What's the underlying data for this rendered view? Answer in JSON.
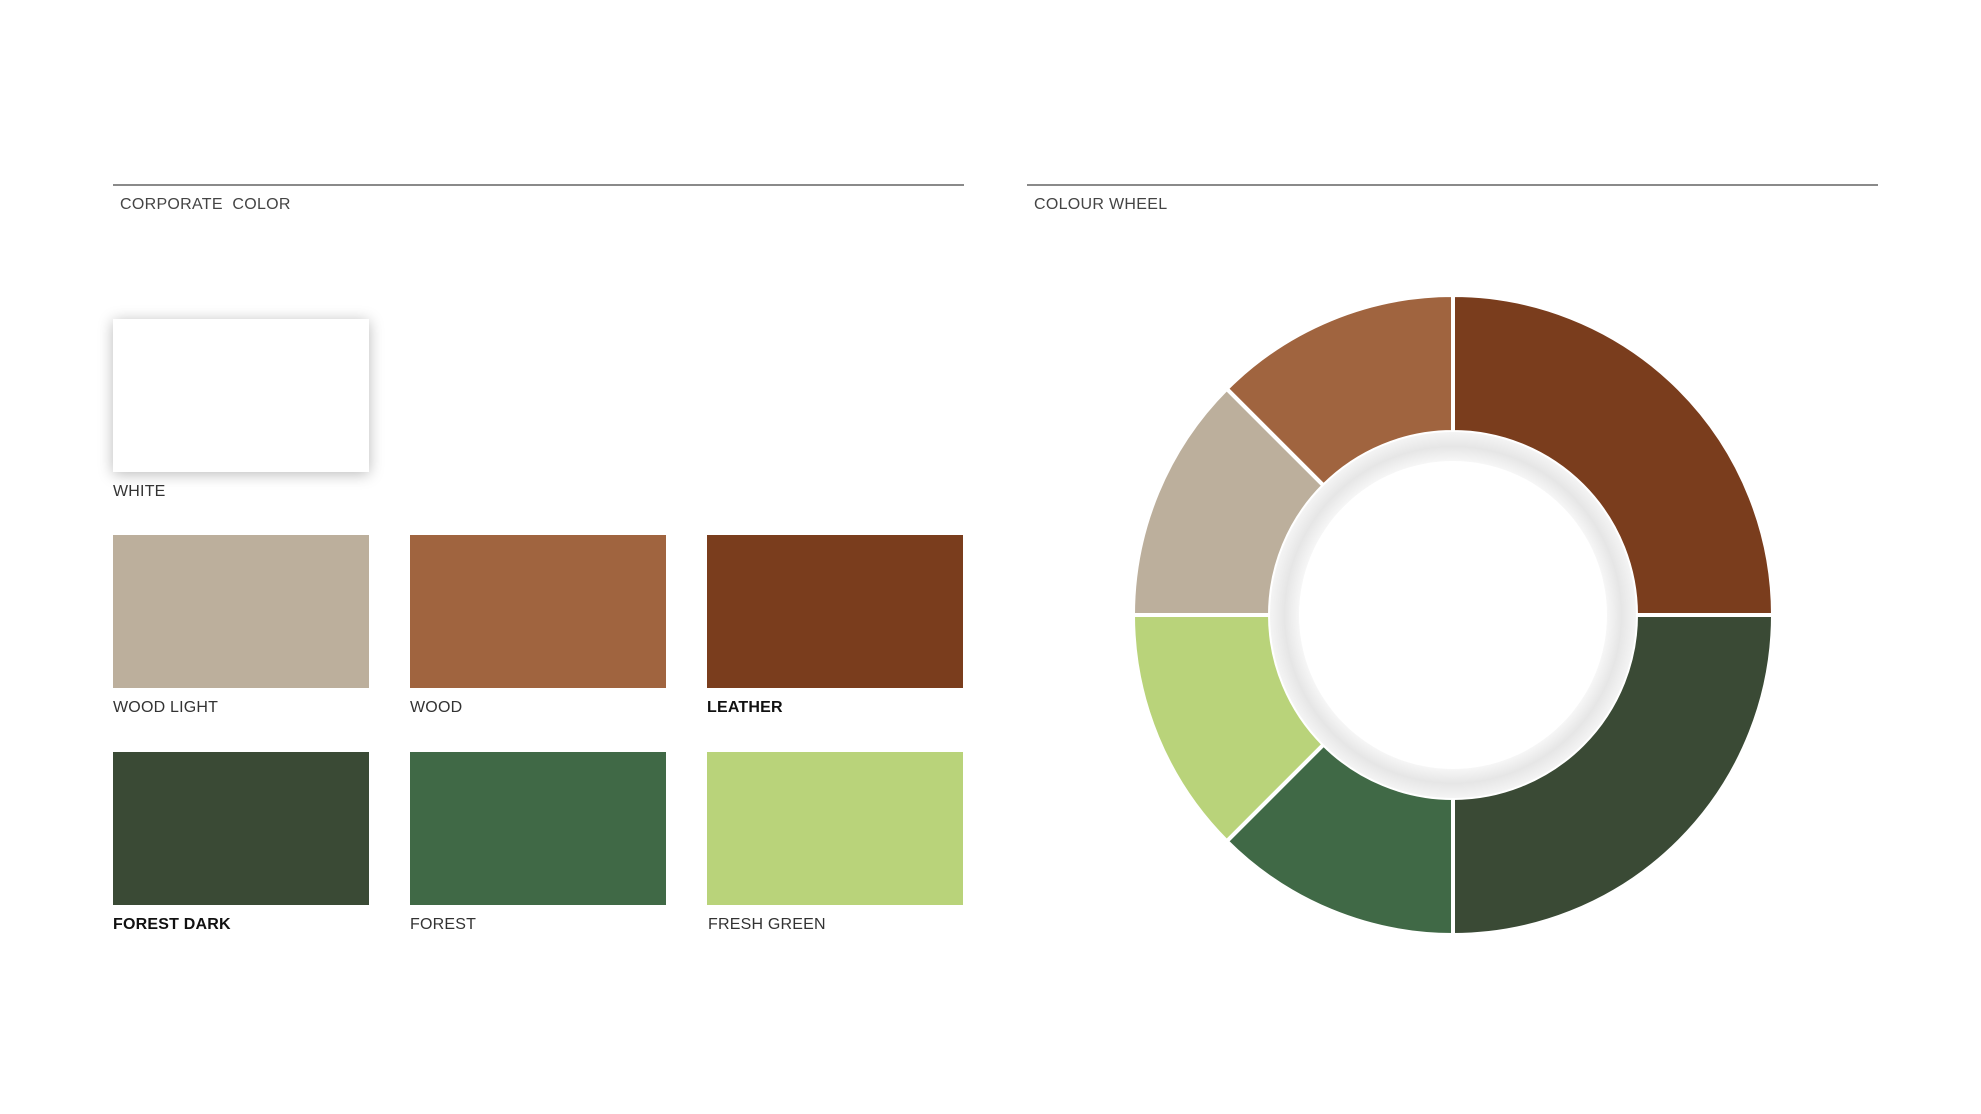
{
  "sections": {
    "corporate_title": "CORPORATE  COLOR",
    "wheel_title": "COLOUR WHEEL"
  },
  "swatches": [
    {
      "label": "WHITE",
      "color": "#FFFFFF",
      "bold": false
    },
    {
      "label": "WOOD LIGHT",
      "color": "#BCAF9C",
      "bold": false
    },
    {
      "label": "WOOD",
      "color": "#A0643F",
      "bold": false
    },
    {
      "label": "LEATHER",
      "color": "#7A3D1D",
      "bold": true
    },
    {
      "label": "FOREST DARK",
      "color": "#3A4A35",
      "bold": true
    },
    {
      "label": "FOREST",
      "color": "#406946",
      "bold": false
    },
    {
      "label": "FRESH GREEN",
      "color": "#B9D37A",
      "bold": false
    }
  ],
  "wheel": {
    "segments": [
      {
        "color": "#7A3D1D",
        "portion": 0.25
      },
      {
        "color": "#3A4A35",
        "portion": 0.25
      },
      {
        "color": "#406946",
        "portion": 0.125
      },
      {
        "color": "#B9D37A",
        "portion": 0.125
      },
      {
        "color": "#BCAF9C",
        "portion": 0.125
      },
      {
        "color": "#A0643F",
        "portion": 0.125
      }
    ]
  }
}
